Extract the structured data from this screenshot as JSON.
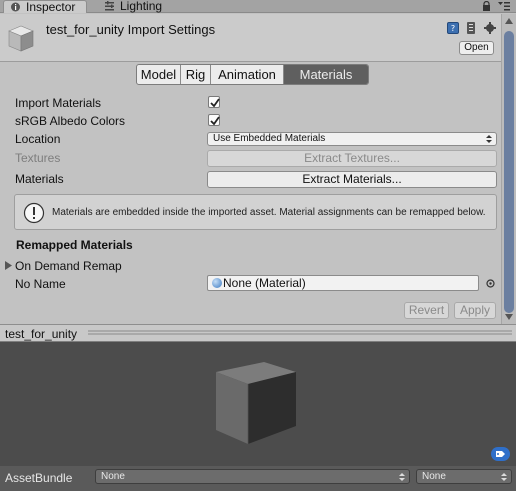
{
  "tabs": {
    "inspector": "Inspector",
    "lighting": "Lighting"
  },
  "header": {
    "title": "test_for_unity Import Settings",
    "open_label": "Open"
  },
  "toolbar": {
    "model": "Model",
    "rig": "Rig",
    "animation": "Animation",
    "materials": "Materials",
    "selected": "Materials"
  },
  "settings": {
    "import_materials_label": "Import Materials",
    "import_materials_checked": true,
    "srgb_label": "sRGB Albedo Colors",
    "srgb_checked": true,
    "location_label": "Location",
    "location_value": "Use Embedded Materials",
    "textures_label": "Textures",
    "extract_textures_label": "Extract Textures...",
    "materials_label": "Materials",
    "extract_materials_label": "Extract Materials...",
    "info_text": "Materials are embedded inside the imported asset. Material assignments can be remapped below."
  },
  "remapped": {
    "title": "Remapped Materials",
    "on_demand_label": "On Demand Remap",
    "no_name_label": "No Name",
    "no_name_value": "None (Material)"
  },
  "actions": {
    "revert": "Revert",
    "apply": "Apply"
  },
  "preview": {
    "title": "test_for_unity"
  },
  "footer": {
    "asset_bundle_label": "AssetBundle",
    "bundle_name": "None",
    "bundle_variant": "None"
  },
  "colors": {
    "selected_tab_bg": "#5f5f5f",
    "scroll_thumb": "#6b7fa0",
    "preview_bg": "#4c4c4c"
  }
}
